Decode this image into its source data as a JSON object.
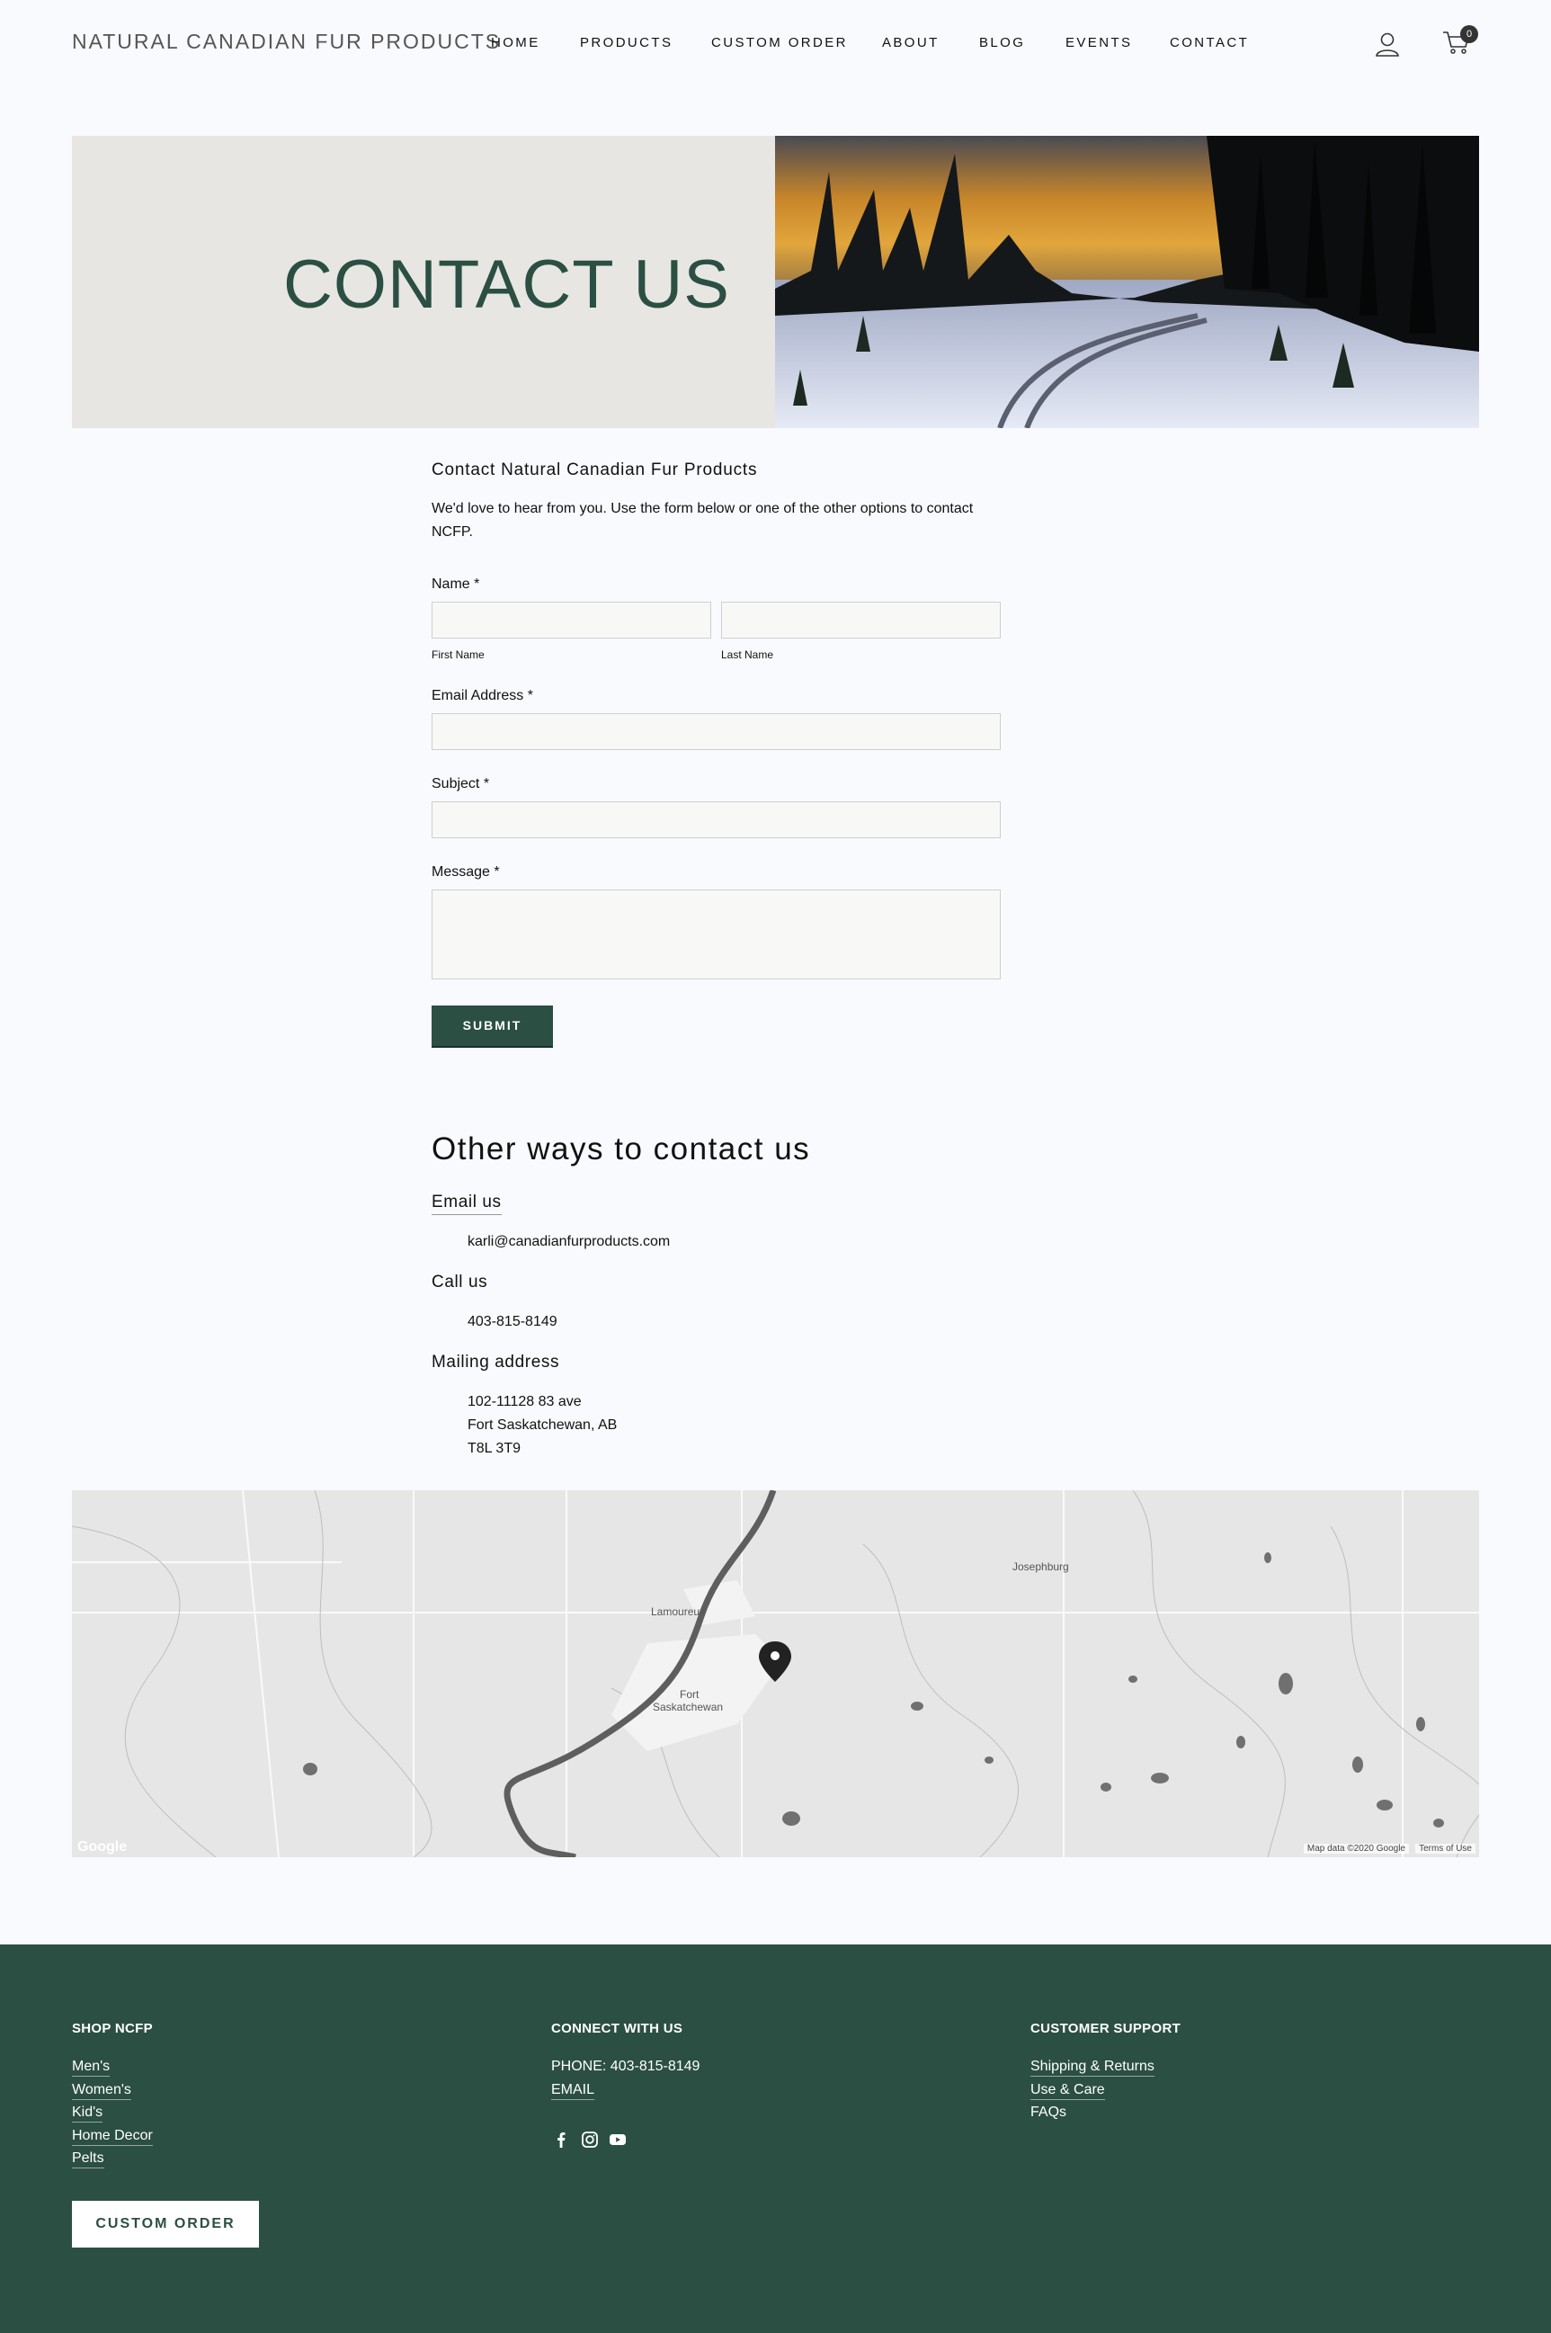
{
  "header": {
    "brand": "NATURAL CANADIAN FUR PRODUCTS",
    "nav": [
      "HOME",
      "PRODUCTS",
      "CUSTOM ORDER",
      "ABOUT",
      "BLOG",
      "EVENTS",
      "CONTACT"
    ],
    "cart_count": "0"
  },
  "hero": {
    "title": "CONTACT US"
  },
  "form": {
    "heading": "Contact Natural Canadian Fur Products",
    "intro": "We'd love to hear from you. Use the form below or one of the other options to contact NCFP.",
    "name_label": "Name *",
    "first_name_label": "First Name",
    "last_name_label": "Last Name",
    "email_label": "Email Address *",
    "subject_label": "Subject *",
    "message_label": "Message *",
    "submit_label": "SUBMIT"
  },
  "other": {
    "title": "Other ways to contact us",
    "email_head": "Email us",
    "email_value": "karli@canadianfurproducts.com",
    "call_head": "Call us",
    "phone_value": "403-815-8149",
    "mail_head": "Mailing address",
    "address_line1": "102-11128 83 ave",
    "address_line2": "Fort Saskatchewan, AB",
    "address_line3": "T8L 3T9"
  },
  "map": {
    "labels": {
      "lamoureux": "Lamoureux",
      "fort": "Fort",
      "saskatchewan": "Saskatchewan",
      "josephburg": "Josephburg",
      "google": "Google"
    },
    "credit": "Map data ©2020 Google",
    "terms": "Terms of Use"
  },
  "footer": {
    "shop_head": "SHOP NCFP",
    "shop_links": [
      "Men's",
      "Women's",
      "Kid's",
      "Home Decor",
      "Pelts"
    ],
    "custom_order": "CUSTOM ORDER",
    "connect_head": "CONNECT WITH US",
    "phone": "PHONE: 403-815-8149",
    "email": "EMAIL",
    "support_head": "CUSTOMER SUPPORT",
    "support_links": [
      "Shipping & Returns",
      "Use & Care",
      "FAQs"
    ]
  },
  "colors": {
    "brand_green": "#2b4f43",
    "page_bg": "#f9fafd",
    "hero_bg": "#e7e6e3"
  }
}
